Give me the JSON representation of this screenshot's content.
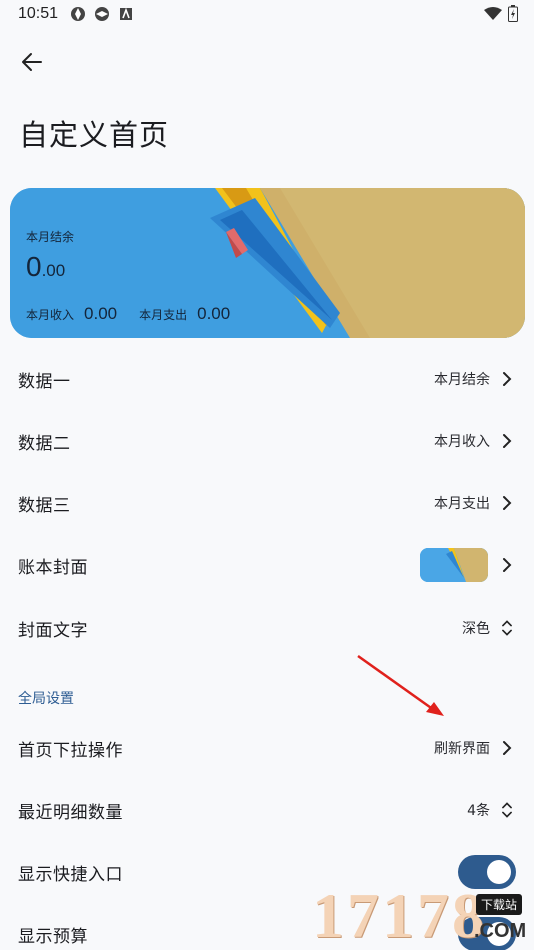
{
  "status_bar": {
    "time": "10:51"
  },
  "header": {
    "title": "自定义首页"
  },
  "cover": {
    "balance_label": "本月结余",
    "balance_int": "0",
    "balance_dec": ".00",
    "income_label": "本月收入",
    "income_value": "0.00",
    "expense_label": "本月支出",
    "expense_value": "0.00"
  },
  "settings": {
    "data1": {
      "title": "数据一",
      "value": "本月结余"
    },
    "data2": {
      "title": "数据二",
      "value": "本月收入"
    },
    "data3": {
      "title": "数据三",
      "value": "本月支出"
    },
    "cover_image": {
      "title": "账本封面"
    },
    "cover_text": {
      "title": "封面文字",
      "value": "深色"
    }
  },
  "global": {
    "header": "全局设置",
    "pull_action": {
      "title": "首页下拉操作",
      "value": "刷新界面"
    },
    "recent_count": {
      "title": "最近明细数量",
      "value": "4条"
    },
    "quick_entry": {
      "title": "显示快捷入口",
      "enabled": true
    },
    "budget": {
      "title": "显示预算",
      "enabled": true
    }
  },
  "watermark": {
    "digits": "17178",
    "tag": "下载站",
    "suffix": ".COM"
  },
  "colors": {
    "accent": "#2e5b8e",
    "section": "#2e5d93",
    "background": "#f8f9fb"
  }
}
